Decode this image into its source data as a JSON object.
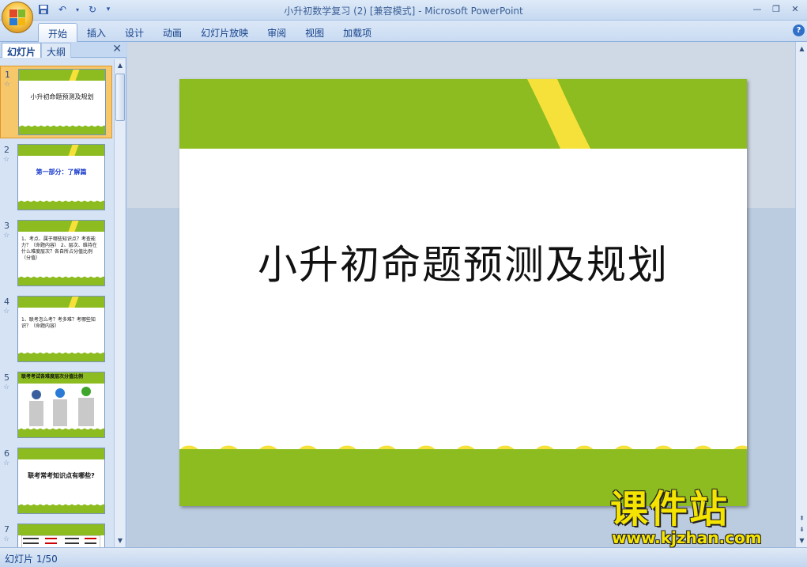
{
  "window": {
    "title": "小升初数学复习 (2) [兼容模式]",
    "app_name": "Microsoft PowerPoint",
    "title_separator": " - "
  },
  "ribbon": {
    "tabs": [
      "开始",
      "插入",
      "设计",
      "动画",
      "幻灯片放映",
      "审阅",
      "视图",
      "加载项"
    ],
    "active_tab": "开始"
  },
  "left_pane": {
    "tabs": [
      "幻灯片",
      "大纲"
    ],
    "active_tab": "幻灯片",
    "thumbnails": [
      {
        "number": "1",
        "text": "小升初命题预测及规划",
        "selected": true
      },
      {
        "number": "2",
        "text": "第一部分：了解篇",
        "selected": false
      },
      {
        "number": "3",
        "text": "1、考点、属于哪些知识点？考查能力？（命题内容） 2、层次、维持在什么难度层次？各自所占分值比例（分值）",
        "selected": false
      },
      {
        "number": "4",
        "text": "1、联考怎么考？考多难？考哪些知识？（命题内容）",
        "selected": false
      },
      {
        "number": "5",
        "text": "联考考试各难度层次分值比例",
        "selected": false
      },
      {
        "number": "6",
        "text": "联考常考知识点有哪些?",
        "selected": false
      },
      {
        "number": "7",
        "text": "",
        "selected": false
      }
    ]
  },
  "slide": {
    "title": "小升初命题预测及规划"
  },
  "status": {
    "slide_indicator": "幻灯片 1/50"
  },
  "watermark": {
    "name": "课件站",
    "url": "www.kjzhan.com"
  },
  "colors": {
    "slide_green": "#8cbc1f",
    "slide_yellow": "#f6e13a",
    "watermark_yellow": "#f5e400",
    "ribbon_text": "#15428b"
  }
}
